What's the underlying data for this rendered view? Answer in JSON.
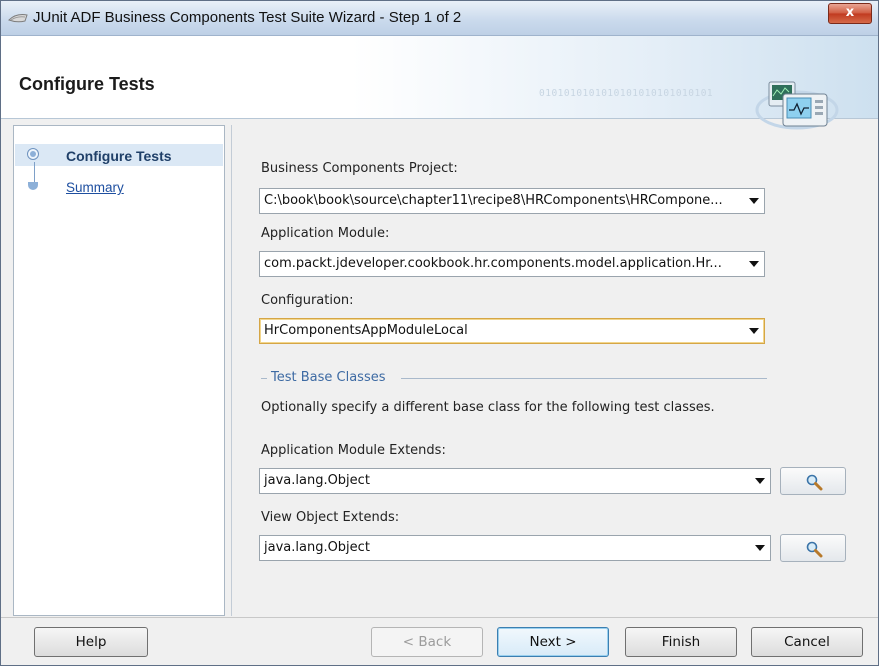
{
  "window": {
    "title": "JUnit ADF Business Components Test Suite Wizard - Step 1 of 2",
    "close_label": "x"
  },
  "header": {
    "title": "Configure Tests",
    "binary_text": "0101010101010101010101010101",
    "art_icon": "test-monitor-icon"
  },
  "nav": {
    "items": [
      {
        "label": "Configure Tests",
        "selected": true
      },
      {
        "label": "Summary",
        "selected": false
      }
    ]
  },
  "form": {
    "project": {
      "label": "Business Components Project:",
      "value": "C:\\book\\book\\source\\chapter11\\recipe8\\HRComponents\\HRCompone..."
    },
    "app_module": {
      "label": "Application Module:",
      "value": "com.packt.jdeveloper.cookbook.hr.components.model.application.Hr..."
    },
    "configuration": {
      "label": "Configuration:",
      "value": "HrComponentsAppModuleLocal"
    },
    "section": {
      "title": "Test Base Classes",
      "description": "Optionally specify a different base class for the following test classes."
    },
    "am_extends": {
      "label": "Application Module Extends:",
      "value": "java.lang.Object"
    },
    "vo_extends": {
      "label": "View Object Extends:",
      "value": "java.lang.Object"
    }
  },
  "buttons": {
    "help": "Help",
    "back": "< Back",
    "next": "Next >",
    "finish": "Finish",
    "cancel": "Cancel"
  },
  "colors": {
    "accent": "#3d6aa3",
    "close": "#c0391f",
    "focus": "#d5a646"
  }
}
